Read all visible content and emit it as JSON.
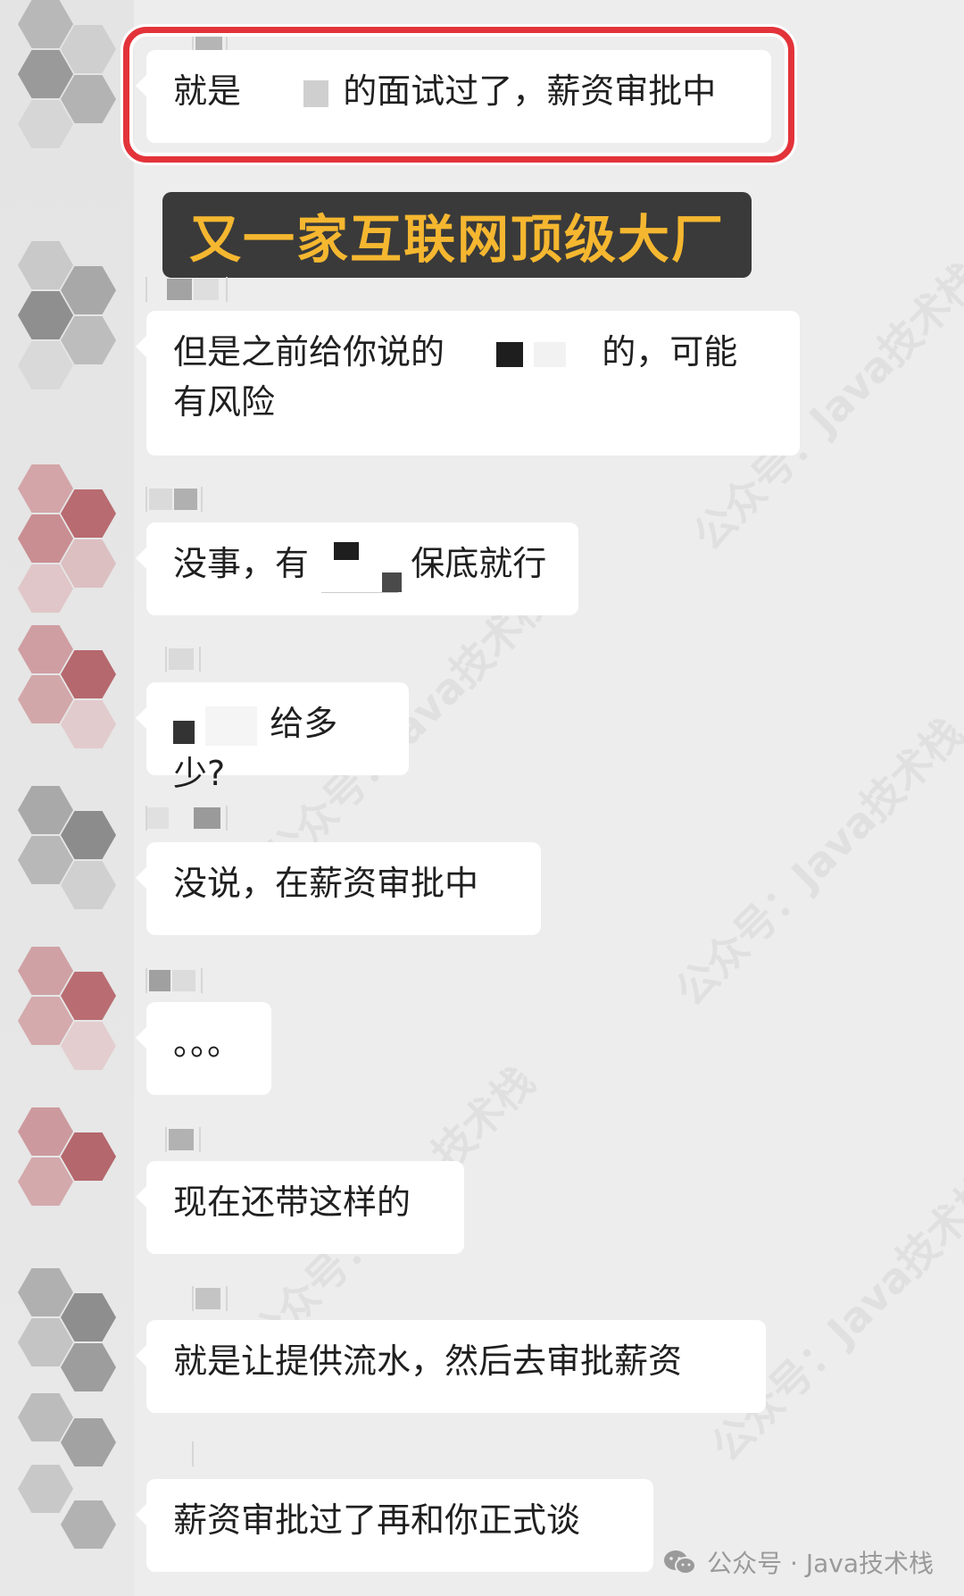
{
  "banner": {
    "text": "又一家互联网顶级大厂"
  },
  "messages": [
    {
      "before": "就是",
      "after": "的面试过了，薪资审批中"
    },
    {
      "line1_before": "但是之前给你说的",
      "line1_after": "的，可能",
      "line2": "有风险"
    },
    {
      "before": "没事，有",
      "after": "保底就行"
    },
    {
      "after": "给多少?"
    },
    {
      "text": "没说，在薪资审批中"
    },
    {
      "text": "。。。"
    },
    {
      "text": "现在还带这样的"
    },
    {
      "text": "就是让提供流水，然后去审批薪资"
    },
    {
      "text": "薪资审批过了再和你正式谈"
    }
  ],
  "watermark": {
    "text": "公众号：Java技术栈"
  },
  "footer": {
    "label": "公众号 · Java技术栈"
  },
  "colors": {
    "highlight": "#e3333a",
    "banner_bg": "#3a3a3a",
    "banner_text": "#f5b730"
  }
}
